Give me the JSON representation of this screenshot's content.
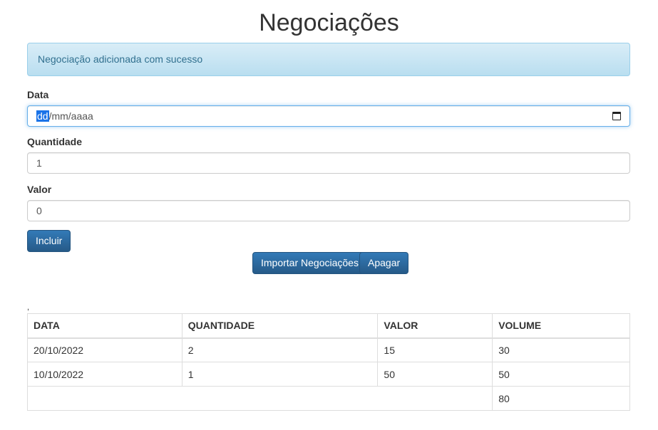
{
  "page": {
    "title": "Negociações"
  },
  "alert": {
    "message": "Negociação adicionada com sucesso"
  },
  "form": {
    "date": {
      "label": "Data",
      "segment_selected": "dd",
      "placeholder_rest": "/mm/aaaa"
    },
    "quantity": {
      "label": "Quantidade",
      "value": "1"
    },
    "value": {
      "label": "Valor",
      "value": "0"
    },
    "submit_label": "Incluir"
  },
  "actions": {
    "import_label": "Importar Negociações",
    "clear_label": "Apagar"
  },
  "separator_text": ",",
  "table": {
    "headers": [
      "DATA",
      "QUANTIDADE",
      "VALOR",
      "VOLUME"
    ],
    "rows": [
      [
        "20/10/2022",
        "2",
        "15",
        "30"
      ],
      [
        "10/10/2022",
        "1",
        "50",
        "50"
      ]
    ],
    "footer_total": "80"
  },
  "colors": {
    "primary": "#337ab7",
    "alert_bg": "#d9edf7",
    "alert_text": "#31708f"
  }
}
